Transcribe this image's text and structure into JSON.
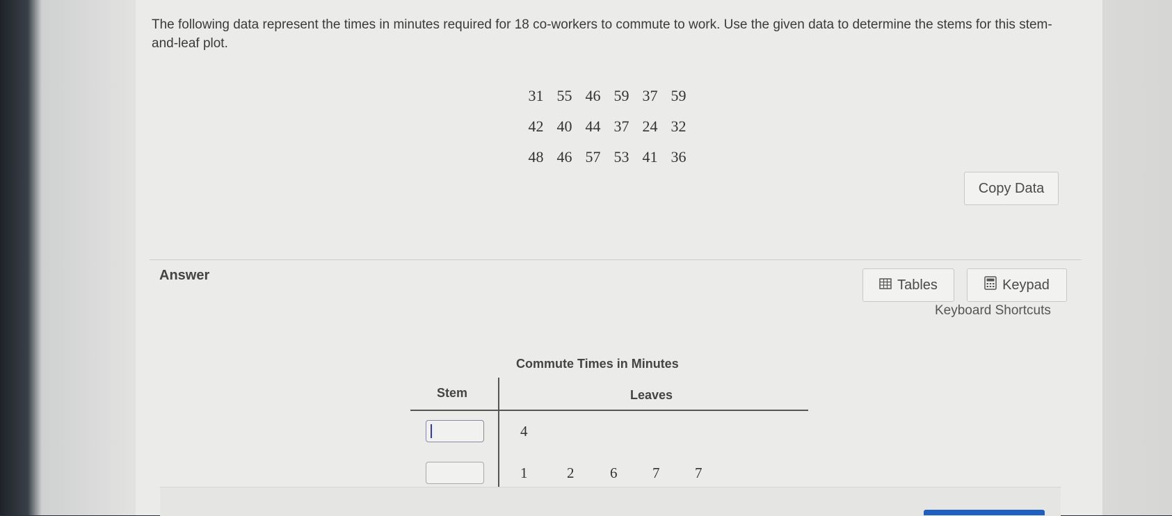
{
  "question": {
    "text": "The following data represent the times in minutes required for 18 co-workers to commute to work. Use the given data to determine the stems for this stem-and-leaf plot."
  },
  "data_rows": [
    [
      "31",
      "55",
      "46",
      "59",
      "37",
      "59"
    ],
    [
      "42",
      "40",
      "44",
      "37",
      "24",
      "32"
    ],
    [
      "48",
      "46",
      "57",
      "53",
      "41",
      "36"
    ]
  ],
  "buttons": {
    "copy_data": "Copy Data",
    "tables": "Tables",
    "keypad": "Keypad"
  },
  "icons": {
    "tables": "table-grid-icon",
    "keypad": "calculator-icon"
  },
  "answer": {
    "label": "Answer",
    "shortcuts": "Keyboard Shortcuts"
  },
  "stem_leaf": {
    "title": "Commute Times in Minutes",
    "stem_header": "Stem",
    "leaves_header": "Leaves",
    "rows": [
      {
        "stem_value": "",
        "leaves": [
          "4"
        ]
      },
      {
        "stem_value": "",
        "leaves": [
          "1",
          "2",
          "6",
          "7",
          "7"
        ]
      }
    ]
  },
  "colors": {
    "caret": "#2b3ac8",
    "submit": "#1e5fc0"
  }
}
